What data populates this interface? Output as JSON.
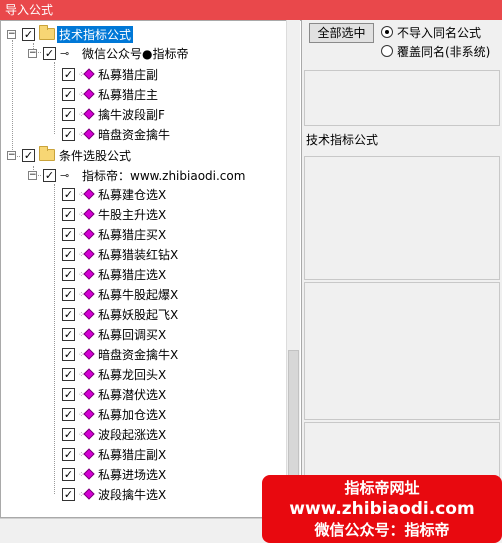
{
  "window": {
    "title": "导入公式"
  },
  "tree": {
    "group1": {
      "label": "技术指标公式",
      "sub": {
        "label": "微信公众号●指标帝",
        "items": [
          "私募猎庄副",
          "私募猎庄主",
          "擒牛波段副F",
          "暗盘资金擒牛"
        ]
      }
    },
    "group2": {
      "label": "条件选股公式",
      "sub": {
        "label": "指标帝：www.zhibiaodi.com",
        "items": [
          "私募建仓选X",
          "牛股主升选X",
          "私募猎庄买X",
          "私募猎装红钻X",
          "私募猎庄选X",
          "私募牛股起爆X",
          "私募妖股起飞X",
          "私募回调买X",
          "暗盘资金擒牛X",
          "私募龙回头X",
          "私募潜伏选X",
          "私募加仓选X",
          "波段起涨选X",
          "私募猎庄副X",
          "私募进场选X",
          "波段擒牛选X"
        ]
      }
    },
    "check_mark": "✓",
    "expanded_mark": "−"
  },
  "options": {
    "select_all": "全部选中",
    "radio1": "不导入同名公式",
    "radio2": "覆盖同名(非系统)",
    "info_title": "技术指标公式"
  },
  "promo": {
    "line1": "指标帝网址",
    "line2": "www.zhibiaodi.com",
    "line3": "微信公众号：指标帝"
  }
}
